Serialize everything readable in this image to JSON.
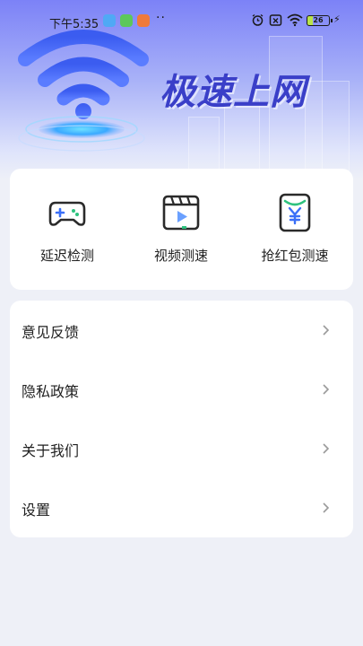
{
  "status_bar": {
    "time": "下午5:35",
    "extra_dots": "··",
    "battery_level": "26",
    "battery_level_fraction": 0.26,
    "icons": [
      "message-app-icon",
      "wechat-app-icon",
      "taobao-app-icon",
      "alarm-icon",
      "no-sim-icon",
      "wifi-signal-icon",
      "battery-icon",
      "charging-icon"
    ]
  },
  "hero": {
    "title": "极速上网",
    "art_icon": "wifi-icon"
  },
  "tools": [
    {
      "label": "延迟检测",
      "icon": "gamepad-icon"
    },
    {
      "label": "视频测速",
      "icon": "video-clapper-icon"
    },
    {
      "label": "抢红包测速",
      "icon": "red-envelope-icon"
    }
  ],
  "menu": [
    {
      "label": "意见反馈",
      "icon": "chevron-right-icon"
    },
    {
      "label": "隐私政策",
      "icon": "chevron-right-icon"
    },
    {
      "label": "关于我们",
      "icon": "chevron-right-icon"
    },
    {
      "label": "设置",
      "icon": "chevron-right-icon"
    }
  ],
  "colors": {
    "hero_top": "#7c82f7",
    "title": "#3a3fc8",
    "accent_blue": "#3a6ff7",
    "accent_green": "#2ec27e",
    "page_bg": "#eef0f7"
  }
}
